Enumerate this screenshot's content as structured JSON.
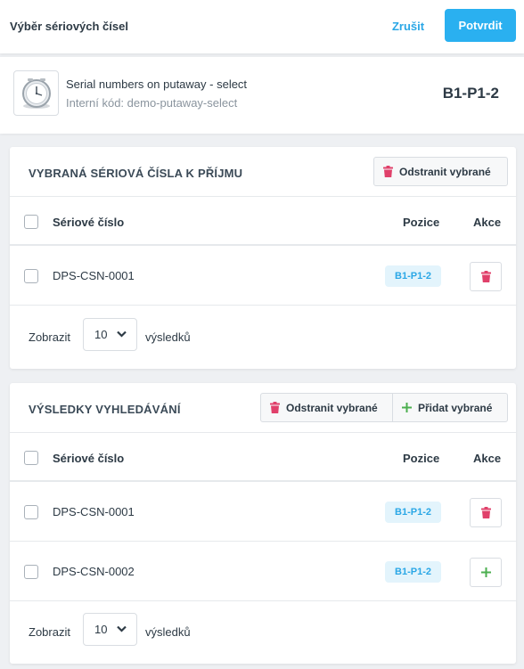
{
  "header": {
    "title": "Výběr sériových čísel",
    "cancel_label": "Zrušit",
    "confirm_label": "Potvrdit"
  },
  "product": {
    "name": "Serial numbers on putaway - select",
    "code": "Interní kód: demo-putaway-select",
    "location": "B1-P1-2",
    "thumbnail_icon": "alarm-clock-icon"
  },
  "colors": {
    "accent": "#2ab0f0",
    "delete": "#e0406a",
    "add": "#4caf50",
    "badge_bg": "#e3f4fc"
  },
  "selected": {
    "title": "VYBRANÁ SÉRIOVÁ ČÍSLA K PŘÍJMU",
    "remove_selected_label": "Odstranit vybrané",
    "columns": {
      "serial": "Sériové číslo",
      "position": "Pozice",
      "action": "Akce"
    },
    "rows": [
      {
        "serial": "DPS-CSN-0001",
        "position": "B1-P1-2",
        "action_icon": "trash-icon"
      }
    ],
    "pager": {
      "show_label": "Zobrazit",
      "page_size": "10",
      "results_label": "výsledků"
    }
  },
  "results": {
    "title": "VÝSLEDKY VYHLEDÁVÁNÍ",
    "remove_selected_label": "Odstranit vybrané",
    "add_selected_label": "Přidat vybrané",
    "columns": {
      "serial": "Sériové číslo",
      "position": "Pozice",
      "action": "Akce"
    },
    "rows": [
      {
        "serial": "DPS-CSN-0001",
        "position": "B1-P1-2",
        "action_icon": "trash-icon"
      },
      {
        "serial": "DPS-CSN-0002",
        "position": "B1-P1-2",
        "action_icon": "plus-icon"
      }
    ],
    "pager": {
      "show_label": "Zobrazit",
      "page_size": "10",
      "results_label": "výsledků"
    }
  }
}
